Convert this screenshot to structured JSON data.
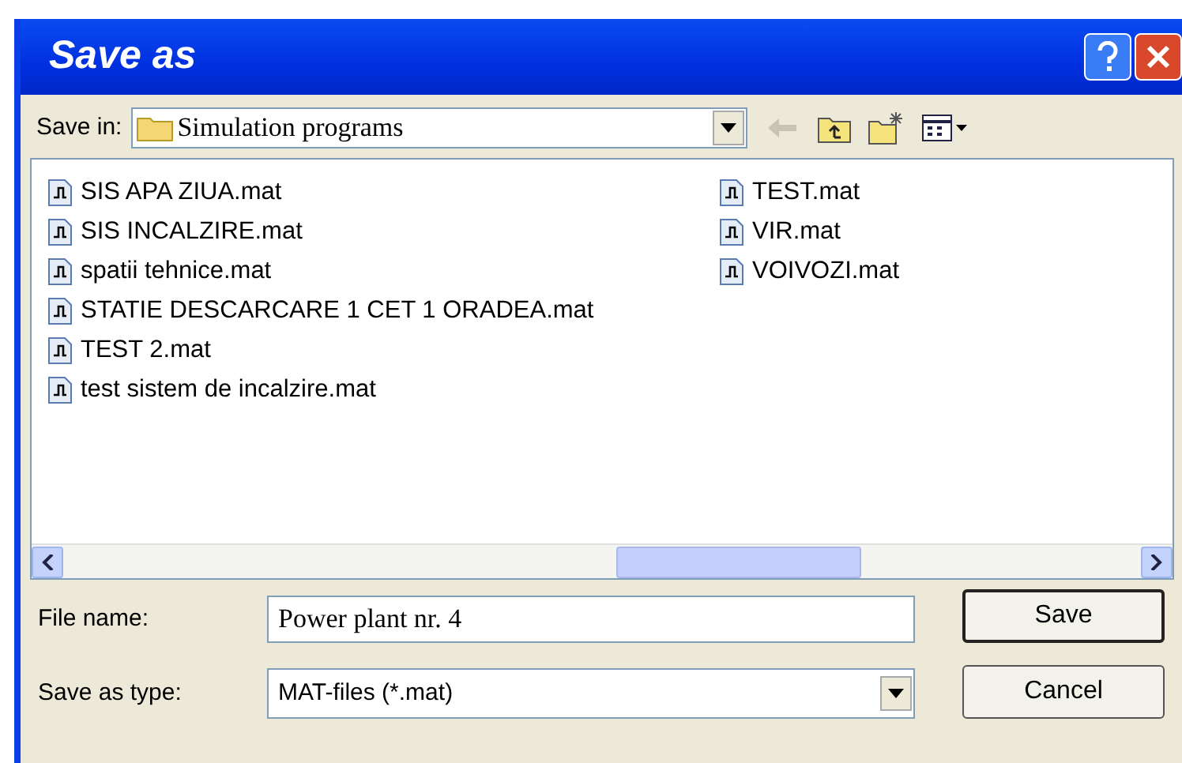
{
  "window": {
    "title": "Save as"
  },
  "save_in": {
    "label": "Save in:",
    "value": "Simulation programs"
  },
  "files": [
    {
      "name": "SIS APA ZIUA.mat"
    },
    {
      "name": "SIS INCALZIRE.mat"
    },
    {
      "name": "spatii tehnice.mat"
    },
    {
      "name": "STATIE DESCARCARE 1 CET 1 ORADEA.mat"
    },
    {
      "name": "TEST 2.mat"
    },
    {
      "name": "test sistem de incalzire.mat"
    },
    {
      "name": "TEST.mat"
    },
    {
      "name": "VIR.mat"
    },
    {
      "name": "VOIVOZI.mat"
    }
  ],
  "file_name": {
    "label": "File name:",
    "value": "Power plant nr. 4"
  },
  "save_as_type": {
    "label": "Save as type:",
    "value": "MAT-files (*.mat)"
  },
  "buttons": [
    {
      "label": "Save",
      "default": true
    },
    {
      "label": "Cancel",
      "default": false
    }
  ]
}
